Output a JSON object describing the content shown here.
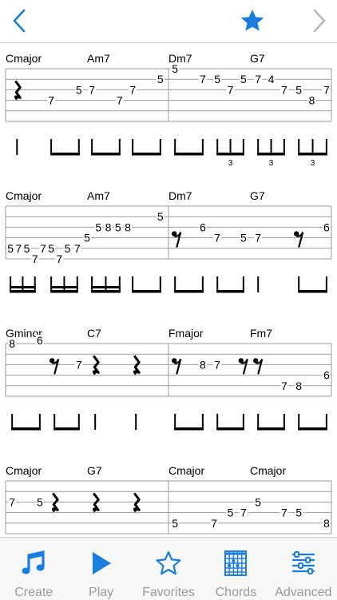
{
  "colors": {
    "accent": "#1a7de0",
    "disabled": "#b8b8b8",
    "ink": "#000000",
    "line": "#9a9a9a"
  },
  "nav": {
    "back_icon": "chevron-left-icon",
    "favorite_icon": "star-filled-icon",
    "forward_icon": "chevron-right-icon"
  },
  "systems": [
    {
      "measures": [
        {
          "chords": [
            {
              "name": "Cmajor",
              "beat": 0
            },
            {
              "name": "Am7",
              "beat": 2
            }
          ],
          "events": [
            {
              "rest": "quarter",
              "pos": 0.07,
              "string": 2
            },
            {
              "fret": "7",
              "pos": 0.28,
              "string": 3
            },
            {
              "fret": "5",
              "pos": 0.45,
              "string": 2
            },
            {
              "fret": "7",
              "pos": 0.53,
              "string": 2
            },
            {
              "fret": "7",
              "pos": 0.7,
              "string": 3
            },
            {
              "fret": "7",
              "pos": 0.78,
              "string": 2
            },
            {
              "fret": "5",
              "pos": 0.95,
              "string": 1
            }
          ],
          "rhythm": [
            {
              "type": "stem",
              "pos": 0.07
            },
            {
              "type": "beam",
              "from": 0.28,
              "to": 0.45
            },
            {
              "type": "beam",
              "from": 0.53,
              "to": 0.7
            },
            {
              "type": "beam",
              "from": 0.78,
              "to": 0.95
            }
          ]
        },
        {
          "chords": [
            {
              "name": "Dm7",
              "beat": 0
            },
            {
              "name": "G7",
              "beat": 2
            }
          ],
          "events": [
            {
              "fret": "5",
              "pos": 0.04,
              "string": 0
            },
            {
              "fret": "7",
              "pos": 0.21,
              "string": 1
            },
            {
              "fret": "5",
              "pos": 0.3,
              "string": 1
            },
            {
              "fret": "7",
              "pos": 0.38,
              "string": 2
            },
            {
              "fret": "5",
              "pos": 0.46,
              "string": 1
            },
            {
              "fret": "7",
              "pos": 0.55,
              "string": 1
            },
            {
              "fret": "4",
              "pos": 0.63,
              "string": 1
            },
            {
              "fret": "7",
              "pos": 0.71,
              "string": 2
            },
            {
              "fret": "5",
              "pos": 0.8,
              "string": 2
            },
            {
              "fret": "8",
              "pos": 0.88,
              "string": 3
            },
            {
              "fret": "7",
              "pos": 0.97,
              "string": 2
            }
          ],
          "rhythm": [
            {
              "type": "beam",
              "from": 0.04,
              "to": 0.21
            },
            {
              "type": "triplet",
              "from": 0.3,
              "to": 0.46,
              "num": "3"
            },
            {
              "type": "triplet",
              "from": 0.55,
              "to": 0.71,
              "num": "3"
            },
            {
              "type": "triplet",
              "from": 0.8,
              "to": 0.97,
              "num": "3"
            }
          ]
        }
      ]
    },
    {
      "measures": [
        {
          "chords": [
            {
              "name": "Cmajor",
              "beat": 0
            },
            {
              "name": "Am7",
              "beat": 2
            }
          ],
          "events": [
            {
              "fret": "5",
              "pos": 0.03,
              "string": 4
            },
            {
              "fret": "7",
              "pos": 0.08,
              "string": 4
            },
            {
              "fret": "5",
              "pos": 0.13,
              "string": 4
            },
            {
              "fret": "7",
              "pos": 0.18,
              "string": 5
            },
            {
              "fret": "7",
              "pos": 0.23,
              "string": 4
            },
            {
              "fret": "5",
              "pos": 0.28,
              "string": 4
            },
            {
              "fret": "7",
              "pos": 0.33,
              "string": 5
            },
            {
              "fret": "5",
              "pos": 0.38,
              "string": 4
            },
            {
              "fret": "7",
              "pos": 0.44,
              "string": 4
            },
            {
              "fret": "5",
              "pos": 0.5,
              "string": 3
            },
            {
              "fret": "5",
              "pos": 0.57,
              "string": 2
            },
            {
              "fret": "8",
              "pos": 0.63,
              "string": 2
            },
            {
              "fret": "5",
              "pos": 0.69,
              "string": 2
            },
            {
              "fret": "8",
              "pos": 0.75,
              "string": 2
            },
            {
              "fret": "5",
              "pos": 0.95,
              "string": 1
            }
          ],
          "rhythm": [
            {
              "type": "beam4",
              "from": 0.03,
              "to": 0.18
            },
            {
              "type": "beam4",
              "from": 0.28,
              "to": 0.44
            },
            {
              "type": "beam4",
              "from": 0.53,
              "to": 0.7
            },
            {
              "type": "beam",
              "from": 0.78,
              "to": 0.95
            }
          ]
        },
        {
          "chords": [
            {
              "name": "Dm7",
              "beat": 0
            },
            {
              "name": "G7",
              "beat": 2
            }
          ],
          "events": [
            {
              "rest": "eighth",
              "pos": 0.05,
              "string": 3
            },
            {
              "fret": "6",
              "pos": 0.21,
              "string": 2
            },
            {
              "fret": "7",
              "pos": 0.3,
              "string": 3
            },
            {
              "fret": "5",
              "pos": 0.46,
              "string": 3
            },
            {
              "fret": "7",
              "pos": 0.55,
              "string": 3
            },
            {
              "rest": "eighth",
              "pos": 0.8,
              "string": 3
            },
            {
              "fret": "6",
              "pos": 0.97,
              "string": 2
            }
          ],
          "rhythm": [
            {
              "type": "beam",
              "from": 0.04,
              "to": 0.21
            },
            {
              "type": "beam",
              "from": 0.3,
              "to": 0.46
            },
            {
              "type": "stem",
              "pos": 0.55
            },
            {
              "type": "beam",
              "from": 0.8,
              "to": 0.97
            }
          ]
        }
      ]
    },
    {
      "measures": [
        {
          "chords": [
            {
              "name": "Gminor",
              "beat": 0
            },
            {
              "name": "C7",
              "beat": 2
            }
          ],
          "events": [
            {
              "fret": "8",
              "pos": 0.04,
              "string": 0
            },
            {
              "fret": "6",
              "pos": 0.21,
              "string": -0.3
            },
            {
              "rest": "eighth",
              "pos": 0.3,
              "string": 2
            },
            {
              "fret": "7",
              "pos": 0.45,
              "string": 2
            },
            {
              "rest": "quarter",
              "pos": 0.55,
              "string": 2
            },
            {
              "rest": "quarter",
              "pos": 0.8,
              "string": 2
            }
          ],
          "rhythm": [
            {
              "type": "beam",
              "from": 0.04,
              "to": 0.21
            },
            {
              "type": "beam",
              "from": 0.3,
              "to": 0.45
            },
            {
              "type": "stem",
              "pos": 0.55
            },
            {
              "type": "stem",
              "pos": 0.8
            }
          ]
        },
        {
          "chords": [
            {
              "name": "Fmajor",
              "beat": 0
            },
            {
              "name": "Fm7",
              "beat": 2
            }
          ],
          "events": [
            {
              "rest": "eighth",
              "pos": 0.05,
              "string": 2
            },
            {
              "fret": "8",
              "pos": 0.21,
              "string": 2
            },
            {
              "fret": "7",
              "pos": 0.3,
              "string": 2
            },
            {
              "rest": "eighth",
              "pos": 0.46,
              "string": 2
            },
            {
              "rest": "eighth",
              "pos": 0.55,
              "string": 2
            },
            {
              "fret": "7",
              "pos": 0.71,
              "string": 4
            },
            {
              "fret": "8",
              "pos": 0.8,
              "string": 4
            },
            {
              "fret": "6",
              "pos": 0.97,
              "string": 3
            }
          ],
          "rhythm": [
            {
              "type": "beam",
              "from": 0.04,
              "to": 0.21
            },
            {
              "type": "beam",
              "from": 0.3,
              "to": 0.46
            },
            {
              "type": "beam",
              "from": 0.55,
              "to": 0.71
            },
            {
              "type": "beam",
              "from": 0.8,
              "to": 0.97
            }
          ]
        }
      ]
    },
    {
      "measures": [
        {
          "chords": [
            {
              "name": "Cmajor",
              "beat": 0
            },
            {
              "name": "G7",
              "beat": 2
            }
          ],
          "events": [
            {
              "fret": "7",
              "pos": 0.04,
              "string": 2
            },
            {
              "fret": "5",
              "pos": 0.21,
              "string": 2
            },
            {
              "rest": "quarter",
              "pos": 0.3,
              "string": 2
            },
            {
              "rest": "quarter",
              "pos": 0.55,
              "string": 2
            },
            {
              "rest": "quarter",
              "pos": 0.8,
              "string": 2
            }
          ],
          "rhythm": []
        },
        {
          "chords": [
            {
              "name": "Cmajor",
              "beat": 0
            },
            {
              "name": "Cmajor",
              "beat": 2
            }
          ],
          "events": [
            {
              "fret": "5",
              "pos": 0.04,
              "string": 4
            },
            {
              "fret": "7",
              "pos": 0.28,
              "string": 4
            },
            {
              "fret": "5",
              "pos": 0.38,
              "string": 3
            },
            {
              "fret": "7",
              "pos": 0.46,
              "string": 3
            },
            {
              "fret": "5",
              "pos": 0.55,
              "string": 2
            },
            {
              "fret": "7",
              "pos": 0.71,
              "string": 3
            },
            {
              "fret": "5",
              "pos": 0.8,
              "string": 3
            },
            {
              "fret": "8",
              "pos": 0.97,
              "string": 4
            }
          ],
          "rhythm": []
        }
      ]
    }
  ],
  "tabs": [
    {
      "label": "Create",
      "icon": "music-note-icon"
    },
    {
      "label": "Play",
      "icon": "play-icon"
    },
    {
      "label": "Favorites",
      "icon": "star-outline-icon"
    },
    {
      "label": "Chords",
      "icon": "chord-grid-icon"
    },
    {
      "label": "Advanced",
      "icon": "sliders-icon"
    }
  ]
}
